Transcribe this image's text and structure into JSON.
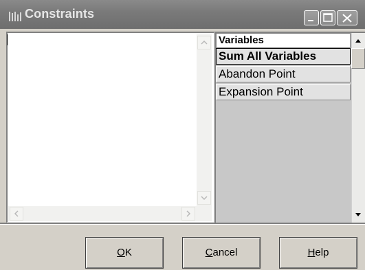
{
  "window": {
    "title": "Constraints",
    "title_icon": "constraints-app-icon"
  },
  "title_buttons": {
    "minimize_icon": "minimize-icon",
    "maximize_icon": "maximize-icon",
    "close_icon": "close-icon"
  },
  "editor": {
    "value": ""
  },
  "variables": {
    "header": "Variables",
    "items": [
      {
        "label": "Sum All Variables",
        "selected": true
      },
      {
        "label": "Abandon Point",
        "selected": false
      },
      {
        "label": "Expansion Point",
        "selected": false
      }
    ]
  },
  "buttons": {
    "ok": {
      "access_key": "O",
      "rest": "K"
    },
    "cancel": {
      "access_key": "C",
      "rest": "ancel"
    },
    "help": {
      "access_key": "H",
      "rest": "elp"
    }
  }
}
